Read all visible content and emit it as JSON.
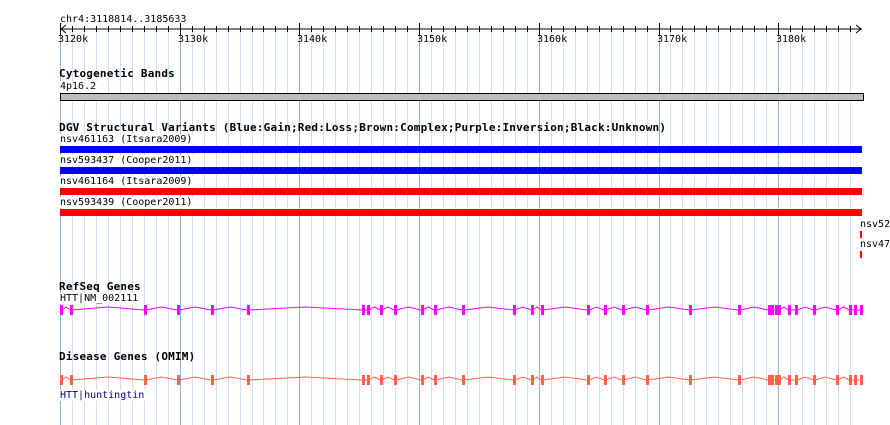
{
  "location": "chr4:3118814..3185633",
  "ruler": {
    "ticks": [
      "3120k",
      "3130k",
      "3140k",
      "3150k",
      "3160k",
      "3170k",
      "3180k"
    ]
  },
  "tracks": {
    "cytoband": {
      "title": "Cytogenetic Bands",
      "band_label": "4p16.2"
    },
    "dgv": {
      "title": "DGV Structural Variants (Blue:Gain;Red:Loss;Brown:Complex;Purple:Inversion;Black:Unknown)",
      "variants": [
        {
          "label": "nsv461163 (Itsara2009)",
          "type": "Gain",
          "color": "#0000ff"
        },
        {
          "label": "nsv593437 (Cooper2011)",
          "type": "Gain",
          "color": "#0000ff"
        },
        {
          "label": "nsv461164 (Itsara2009)",
          "type": "Loss",
          "color": "#ff0000"
        },
        {
          "label": "nsv593439 (Cooper2011)",
          "type": "Loss",
          "color": "#ff0000"
        }
      ],
      "truncated_labels": [
        "nsv52",
        "nsv47"
      ]
    },
    "refseq": {
      "title": "RefSeq Genes",
      "gene_label": "HTT|NM_002111",
      "color": "#ff00ff"
    },
    "disease": {
      "title": "Disease Genes (OMIM)",
      "gene_label": "HTT|huntingtin",
      "color": "#ff6347",
      "label_color": "#000080"
    }
  }
}
